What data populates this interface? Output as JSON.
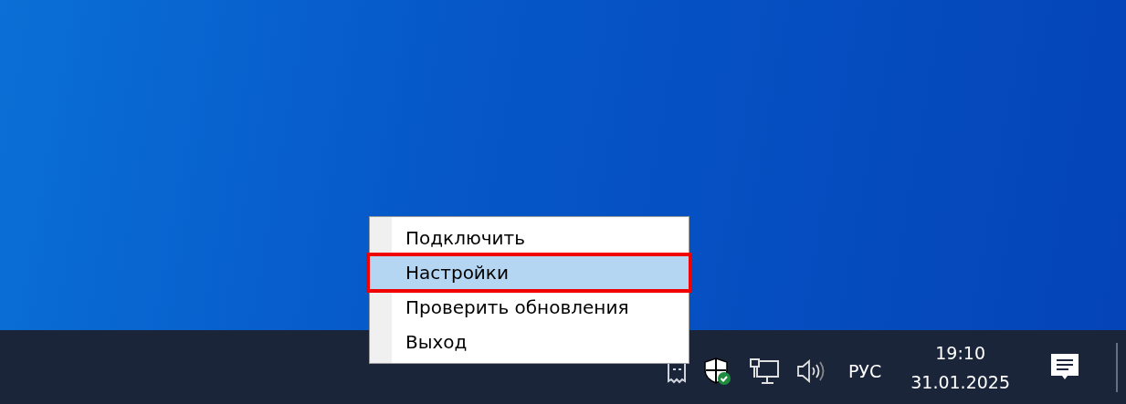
{
  "context_menu": {
    "items": [
      {
        "label": "Подключить",
        "selected": false
      },
      {
        "label": "Настройки",
        "selected": true
      },
      {
        "label": "Проверить обновления",
        "selected": false
      },
      {
        "label": "Выход",
        "selected": false
      }
    ]
  },
  "taskbar": {
    "language": "РУС",
    "time": "19:10",
    "date": "31.01.2025"
  }
}
